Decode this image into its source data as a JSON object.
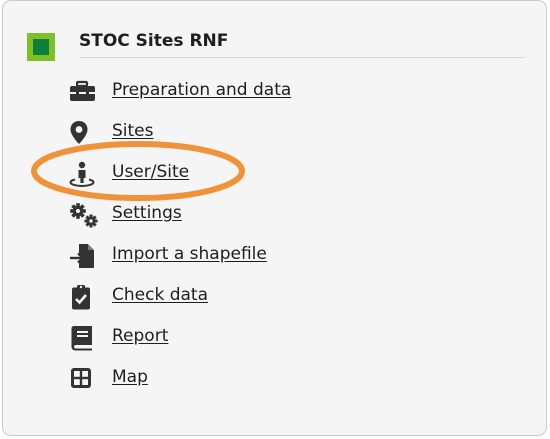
{
  "header": {
    "title": "STOC Sites RNF",
    "logo_colors": {
      "outer": "#7fbf2a",
      "inner": "#0d7f3a"
    }
  },
  "menu": {
    "items": [
      {
        "label": "Preparation and data",
        "icon": "toolbox-icon"
      },
      {
        "label": "Sites",
        "icon": "map-marker-icon"
      },
      {
        "label": "User/Site",
        "icon": "person-pin-icon",
        "highlighted": true
      },
      {
        "label": "Settings",
        "icon": "gears-icon"
      },
      {
        "label": "Import a shapefile",
        "icon": "file-import-icon"
      },
      {
        "label": "Check data",
        "icon": "clipboard-check-icon"
      },
      {
        "label": "Report",
        "icon": "book-icon"
      },
      {
        "label": "Map",
        "icon": "grid-map-icon"
      }
    ]
  },
  "annotation": {
    "color": "#f0923a"
  }
}
